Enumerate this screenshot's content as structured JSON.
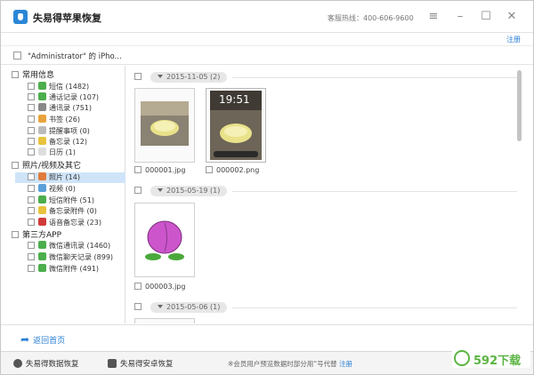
{
  "window": {
    "title": "失易得苹果恢复",
    "hotline": "客服热线：400-606-9600",
    "register": "注册"
  },
  "device": {
    "name": "\"Administrator\" 的 iPho..."
  },
  "tree": {
    "groups": [
      {
        "label": "常用信息",
        "items": [
          {
            "label": "短信 (1482)",
            "color": "#4cae4c"
          },
          {
            "label": "通话记录 (107)",
            "color": "#4cae4c"
          },
          {
            "label": "通讯录 (751)",
            "color": "#888888"
          },
          {
            "label": "书签 (26)",
            "color": "#e8a33c"
          },
          {
            "label": "提醒事项 (0)",
            "color": "#bbbbbb"
          },
          {
            "label": "备忘录 (12)",
            "color": "#e8c33c"
          },
          {
            "label": "日历 (1)",
            "color": "#dddddd"
          }
        ]
      },
      {
        "label": "照片/视频及其它",
        "items": [
          {
            "label": "照片 (14)",
            "color": "#e07b3c"
          },
          {
            "label": "视频 (0)",
            "color": "#5aa0d8"
          },
          {
            "label": "短信附件 (51)",
            "color": "#4cae4c"
          },
          {
            "label": "备忘录附件 (0)",
            "color": "#e8c33c"
          },
          {
            "label": "语音备忘录 (23)",
            "color": "#d03a3a"
          }
        ]
      },
      {
        "label": "第三方APP",
        "items": [
          {
            "label": "微信通讯录 (1460)",
            "color": "#4cae4c"
          },
          {
            "label": "微信聊天记录 (899)",
            "color": "#4cae4c"
          },
          {
            "label": "微信附件 (491)",
            "color": "#4cae4c"
          }
        ]
      }
    ]
  },
  "content": {
    "groups": [
      {
        "date": "2015-11-05 (2)",
        "files": [
          "000001.jpg",
          "000002.png"
        ]
      },
      {
        "date": "2015-05-19 (1)",
        "files": [
          "000003.jpg"
        ]
      },
      {
        "date": "2015-05-06 (1)",
        "files": []
      }
    ],
    "phone_time": "19:51"
  },
  "nav": {
    "back": "返回首页"
  },
  "footer": {
    "btn1": "失易得数据恢复",
    "btn2": "失易得安卓恢复",
    "notice": "※会员用户预览数据时部分用“号代替",
    "notice_link": "注册"
  },
  "watermark": {
    "text": "592下载"
  }
}
